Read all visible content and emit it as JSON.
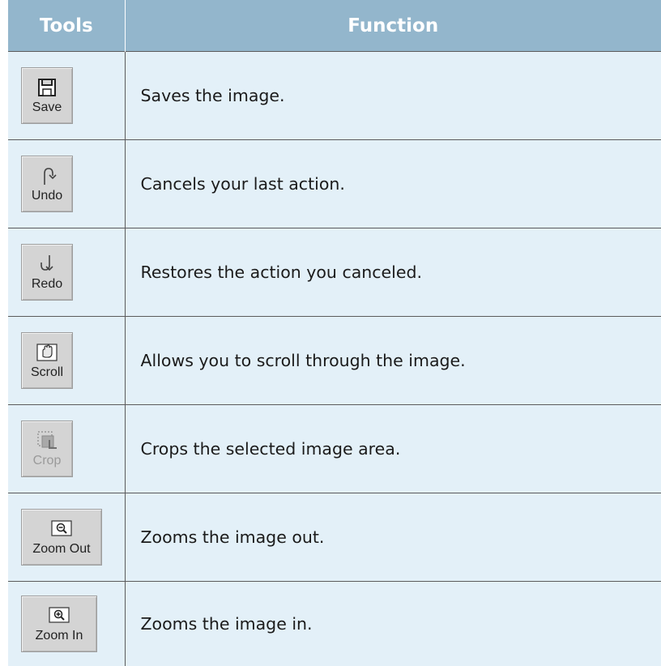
{
  "table": {
    "headers": {
      "tools": "Tools",
      "function": "Function"
    },
    "rows": [
      {
        "tool_label": "Save",
        "icon": "save-icon",
        "description": "Saves the image."
      },
      {
        "tool_label": "Undo",
        "icon": "undo-icon",
        "description": "Cancels your last action."
      },
      {
        "tool_label": "Redo",
        "icon": "redo-icon",
        "description": "Restores the action you canceled."
      },
      {
        "tool_label": "Scroll",
        "icon": "scroll-hand-icon",
        "description": "Allows you to scroll through the image."
      },
      {
        "tool_label": "Crop",
        "icon": "crop-icon",
        "description": "Crops the selected image area.",
        "disabled": true
      },
      {
        "tool_label": "Zoom Out",
        "icon": "zoom-out-icon",
        "description": "Zooms the image out."
      },
      {
        "tool_label": "Zoom In",
        "icon": "zoom-in-icon",
        "description": "Zooms the image in."
      }
    ]
  },
  "colors": {
    "header_background": "#93b6cc",
    "header_text": "#ffffff",
    "row_background": "#e3f0f8",
    "button_face": "#d4d4d4"
  }
}
